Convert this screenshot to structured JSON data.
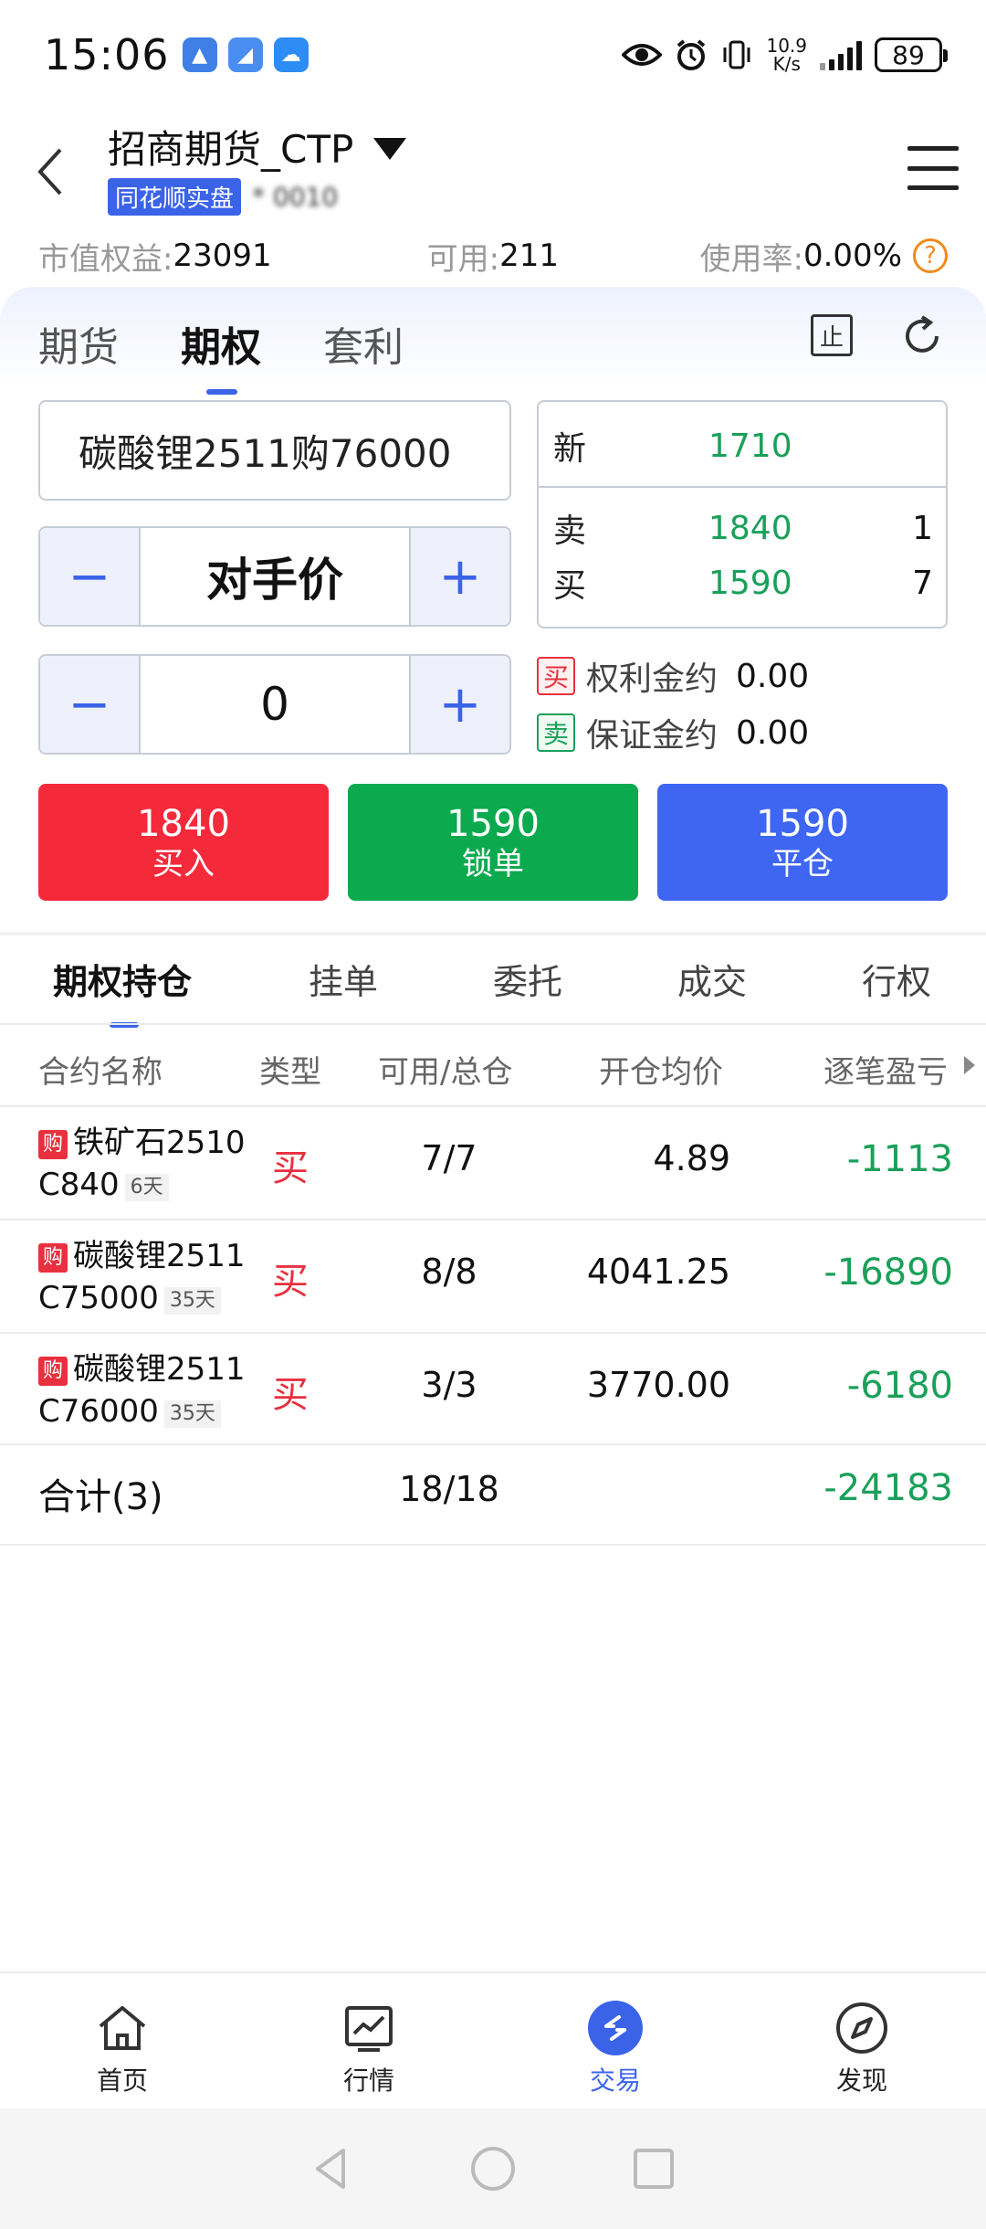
{
  "status_bar": {
    "time": "15:06",
    "net_speed_value": "10.9",
    "net_speed_unit": "K/s",
    "battery": "89",
    "icons": [
      "eye-icon",
      "alarm-icon",
      "vibrate-icon",
      "signal-icon",
      "battery-icon"
    ]
  },
  "header": {
    "title": "招商期货_CTP",
    "account_badge": "同花顺实盘",
    "account_number": "* 0010"
  },
  "equity": {
    "market_value_label": "市值权益:",
    "market_value": "23091",
    "available_label": "可用:",
    "available": "211",
    "usage_label": "使用率:",
    "usage": "0.00%",
    "help": "?"
  },
  "top_tabs": [
    {
      "label": "期货",
      "active": false
    },
    {
      "label": "期权",
      "active": true
    },
    {
      "label": "套利",
      "active": false
    }
  ],
  "stop_icon_label": "止",
  "order": {
    "contract": "碳酸锂2511购76000",
    "price_mode": "对手价",
    "quantity": "0",
    "minus": "−",
    "plus": "+"
  },
  "quote": {
    "last_label": "新",
    "last": "1710",
    "ask_label": "卖",
    "ask": "1840",
    "ask_vol": "1",
    "bid_label": "买",
    "bid": "1590",
    "bid_vol": "7"
  },
  "margin_info": {
    "buy_tag": "买",
    "buy_label": "权利金约",
    "buy_value": "0.00",
    "sell_tag": "卖",
    "sell_label": "保证金约",
    "sell_value": "0.00"
  },
  "actions": {
    "buy": {
      "price": "1840",
      "label": "买入"
    },
    "lock": {
      "price": "1590",
      "label": "锁单"
    },
    "close": {
      "price": "1590",
      "label": "平仓"
    }
  },
  "position_tabs": [
    {
      "label": "期权持仓",
      "active": true
    },
    {
      "label": "挂单",
      "active": false
    },
    {
      "label": "委托",
      "active": false
    },
    {
      "label": "成交",
      "active": false
    },
    {
      "label": "行权",
      "active": false
    }
  ],
  "table": {
    "headers": [
      "合约名称",
      "类型",
      "可用/总仓",
      "开仓均价",
      "逐笔盈亏"
    ],
    "rows": [
      {
        "tag": "购",
        "name_line1": "铁矿石2510",
        "name_line2": "C840",
        "days": "6天",
        "type": "买",
        "position": "7/7",
        "avg_price": "4.89",
        "pnl": "-1113"
      },
      {
        "tag": "购",
        "name_line1": "碳酸锂2511",
        "name_line2": "C75000",
        "days": "35天",
        "type": "买",
        "position": "8/8",
        "avg_price": "4041.25",
        "pnl": "-16890"
      },
      {
        "tag": "购",
        "name_line1": "碳酸锂2511",
        "name_line2": "C76000",
        "days": "35天",
        "type": "买",
        "position": "3/3",
        "avg_price": "3770.00",
        "pnl": "-6180"
      }
    ],
    "total_label": "合计(3)",
    "total_position": "18/18",
    "total_pnl": "-24183"
  },
  "bottom_nav": [
    {
      "label": "首页",
      "icon": "home-icon",
      "active": false
    },
    {
      "label": "行情",
      "icon": "chart-icon",
      "active": false
    },
    {
      "label": "交易",
      "icon": "trade-icon",
      "active": true
    },
    {
      "label": "发现",
      "icon": "compass-icon",
      "active": false
    }
  ],
  "colors": {
    "accent": "#3a63e8",
    "buy_red": "#f42a3b",
    "lock_green": "#0caa4f",
    "close_blue": "#3e66f3",
    "loss_green": "#1aa05a"
  }
}
